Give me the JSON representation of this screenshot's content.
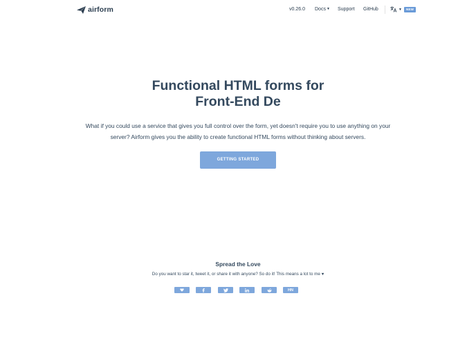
{
  "navbar": {
    "logo_text": "airform",
    "version": "v0.26.0",
    "docs": "Docs",
    "support": "Support",
    "github": "GitHub",
    "new_badge": "NEW"
  },
  "hero": {
    "title": "Functional HTML forms for",
    "subtitle": "Front-End De",
    "description": "What if you could use a service that gives you full control over the form, yet doesn't require you to use anything on your server? Airform gives you the ability to create functional HTML forms without thinking about servers.",
    "cta": "GETTING STARTED"
  },
  "love": {
    "title": "Spread the Love",
    "text": "Do you want to star it, tweet it, or share it with anyone? So do it! This means a lot to me",
    "share_buttons": [
      {
        "icon": "heart-icon"
      },
      {
        "icon": "facebook-icon"
      },
      {
        "icon": "twitter-icon"
      },
      {
        "icon": "linkedin-icon"
      },
      {
        "icon": "reddit-icon"
      },
      {
        "label": "HN"
      }
    ]
  },
  "colors": {
    "accent": "#7ea7dc",
    "text": "#34495e",
    "badge": "#6a9bd8"
  }
}
